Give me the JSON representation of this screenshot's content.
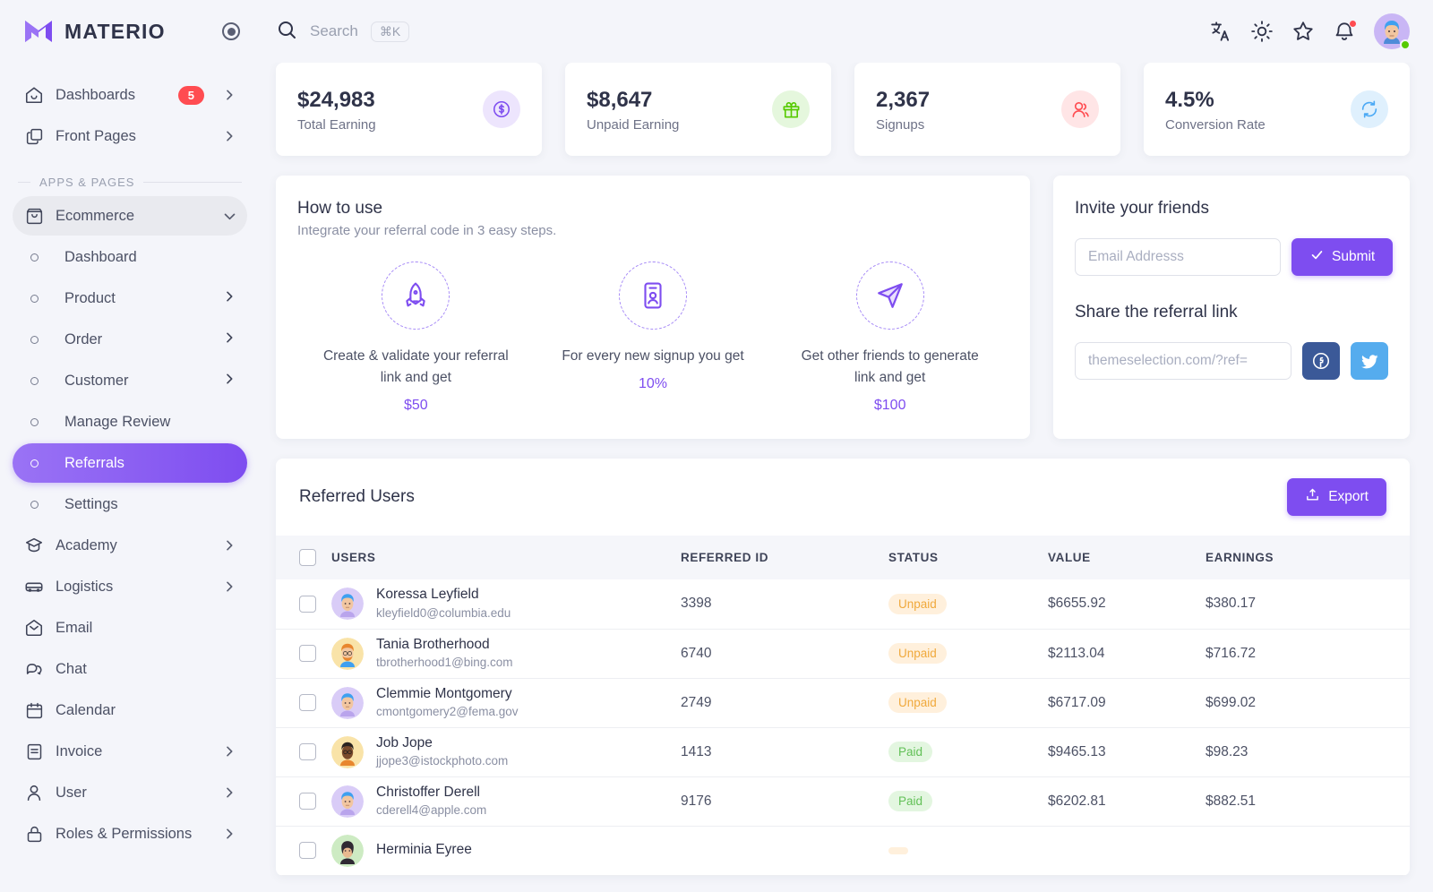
{
  "brand": {
    "name": "MATERIO",
    "logo_icon": "materio-m-logo"
  },
  "search": {
    "placeholder": "Search",
    "shortcut": "⌘K",
    "icon": "search-icon"
  },
  "topbar_icons": [
    {
      "name": "translate-icon",
      "label": "Language"
    },
    {
      "name": "sun-icon",
      "label": "Theme"
    },
    {
      "name": "star-icon",
      "label": "Shortcuts"
    },
    {
      "name": "bell-icon",
      "label": "Notifications",
      "has_dot": true
    }
  ],
  "sidebar": {
    "top_items": [
      {
        "label": "Dashboards",
        "icon": "home-icon",
        "badge": "5",
        "chevron": true
      },
      {
        "label": "Front Pages",
        "icon": "copy-icon",
        "chevron": true
      }
    ],
    "section_label": "APPS & PAGES",
    "group": {
      "label": "Ecommerce",
      "icon": "shopping-bag-icon",
      "expanded": true
    },
    "sub_items": [
      {
        "label": "Dashboard",
        "chevron": false,
        "active": false
      },
      {
        "label": "Product",
        "chevron": true,
        "active": false
      },
      {
        "label": "Order",
        "chevron": true,
        "active": false
      },
      {
        "label": "Customer",
        "chevron": true,
        "active": false
      },
      {
        "label": "Manage Review",
        "chevron": false,
        "active": false
      },
      {
        "label": "Referrals",
        "chevron": false,
        "active": true
      },
      {
        "label": "Settings",
        "chevron": false,
        "active": false
      }
    ],
    "bottom_items": [
      {
        "label": "Academy",
        "icon": "graduation-cap-icon",
        "chevron": true
      },
      {
        "label": "Logistics",
        "icon": "car-icon",
        "chevron": true
      },
      {
        "label": "Email",
        "icon": "envelope-open-icon",
        "chevron": false
      },
      {
        "label": "Chat",
        "icon": "chat-bubbles-icon",
        "chevron": false
      },
      {
        "label": "Calendar",
        "icon": "calendar-icon",
        "chevron": false
      },
      {
        "label": "Invoice",
        "icon": "invoice-icon",
        "chevron": true
      },
      {
        "label": "User",
        "icon": "person-icon",
        "chevron": true
      },
      {
        "label": "Roles & Permissions",
        "icon": "lock-icon",
        "chevron": true
      }
    ]
  },
  "stats": [
    {
      "value": "$24,983",
      "label": "Total Earning",
      "icon": "dollar-circle-icon",
      "color": "#7E4DF0",
      "bg": "#EDE5FD"
    },
    {
      "value": "$8,647",
      "label": "Unpaid Earning",
      "icon": "gift-icon",
      "color": "#56CA00",
      "bg": "#E5F7DD"
    },
    {
      "value": "2,367",
      "label": "Signups",
      "icon": "users-icon",
      "color": "#FF4C51",
      "bg": "#FFE5E6"
    },
    {
      "value": "4.5%",
      "label": "Conversion Rate",
      "icon": "refresh-icon",
      "color": "#4BA9F5",
      "bg": "#DFF0FD"
    }
  ],
  "howto": {
    "title": "How to use",
    "subtitle": "Integrate your referral code in 3 easy steps.",
    "steps": [
      {
        "icon": "rocket-icon",
        "text": "Create & validate your referral link and get",
        "amount": "$50"
      },
      {
        "icon": "id-card-icon",
        "text": "For every new signup you get",
        "amount": "10%"
      },
      {
        "icon": "send-icon",
        "text": "Get other friends to generate link and get",
        "amount": "$100"
      }
    ]
  },
  "invite": {
    "title": "Invite your friends",
    "email_placeholder": "Email Addresss",
    "email_value": "",
    "submit_label": "Submit",
    "submit_icon": "check-icon",
    "share_title": "Share the referral link",
    "link_placeholder": "themeselection.com/?ref=",
    "link_value": "",
    "socials": [
      {
        "name": "facebook-icon",
        "color": "#3B5998"
      },
      {
        "name": "twitter-icon",
        "color": "#55ACEE"
      }
    ]
  },
  "table": {
    "title": "Referred Users",
    "export_label": "Export",
    "export_icon": "upload-icon",
    "columns": [
      "USERS",
      "REFERRED ID",
      "STATUS",
      "VALUE",
      "EARNINGS"
    ],
    "rows": [
      {
        "name": "Koressa Leyfield",
        "email": "kleyfield0@columbia.edu",
        "referred_id": "3398",
        "status": "Unpaid",
        "value": "$6655.92",
        "earnings": "$380.17",
        "avatar": "avatar-purple-blue-hair"
      },
      {
        "name": "Tania Brotherhood",
        "email": "tbrotherhood1@bing.com",
        "referred_id": "6740",
        "status": "Unpaid",
        "value": "$2113.04",
        "earnings": "$716.72",
        "avatar": "avatar-yellow-ginger-beard"
      },
      {
        "name": "Clemmie Montgomery",
        "email": "cmontgomery2@fema.gov",
        "referred_id": "2749",
        "status": "Unpaid",
        "value": "$6717.09",
        "earnings": "$699.02",
        "avatar": "avatar-purple-blue-hair"
      },
      {
        "name": "Job Jope",
        "email": "jjope3@istockphoto.com",
        "referred_id": "1413",
        "status": "Paid",
        "value": "$9465.13",
        "earnings": "$98.23",
        "avatar": "avatar-yellow-dark-skin"
      },
      {
        "name": "Christoffer Derell",
        "email": "cderell4@apple.com",
        "referred_id": "9176",
        "status": "Paid",
        "value": "$6202.81",
        "earnings": "$882.51",
        "avatar": "avatar-purple-blue-hair"
      },
      {
        "name": "Herminia Eyree",
        "email": "",
        "referred_id": "",
        "status": "",
        "value": "",
        "earnings": "",
        "avatar": "avatar-green-dark-hair"
      }
    ]
  }
}
